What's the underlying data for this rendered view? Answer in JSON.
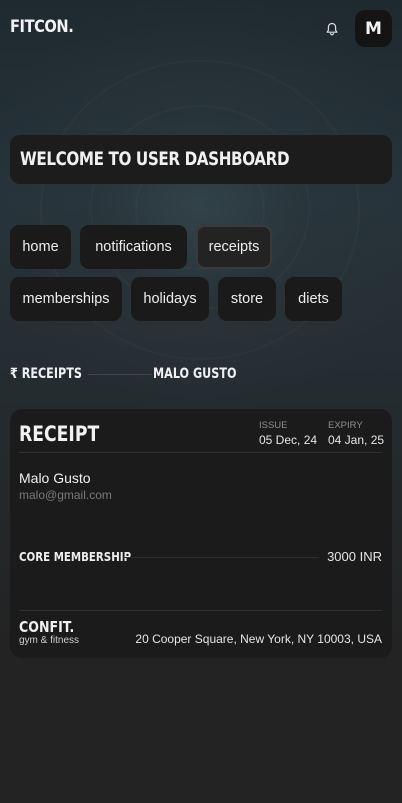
{
  "header": {
    "logo": "FITCON.",
    "bell_icon": "bell-icon",
    "avatar_initial": "M"
  },
  "welcome": {
    "title": "WELCOME TO USER DASHBOARD"
  },
  "nav": {
    "items": [
      {
        "label": "home",
        "active": false
      },
      {
        "label": "notifications",
        "active": false
      },
      {
        "label": "receipts",
        "active": true
      },
      {
        "label": "memberships",
        "active": false
      },
      {
        "label": "holidays",
        "active": false
      },
      {
        "label": "store",
        "active": false
      },
      {
        "label": "diets",
        "active": false
      }
    ]
  },
  "section": {
    "title": "₹ RECEIPTS",
    "user": "MALO GUSTO"
  },
  "receipt": {
    "title": "RECEIPT",
    "issue_label": "ISSUE",
    "issue_date": "05 Dec, 24",
    "expiry_label": "EXPIRY",
    "expiry_date": "04 Jan, 25",
    "customer_name": "Malo Gusto",
    "customer_email": "malo@gmail.com",
    "membership": "CORE MEMBERSHIP",
    "price": "3000 INR",
    "brand": "CONFIT.",
    "brand_tagline": "gym & fitness",
    "address": "20 Cooper Square, New York, NY 10003, USA"
  },
  "colors": {
    "background": "#242424",
    "card": "#1b1b1b",
    "pill": "#1a1a1a",
    "text": "#e8e8e8",
    "muted": "#777777"
  }
}
